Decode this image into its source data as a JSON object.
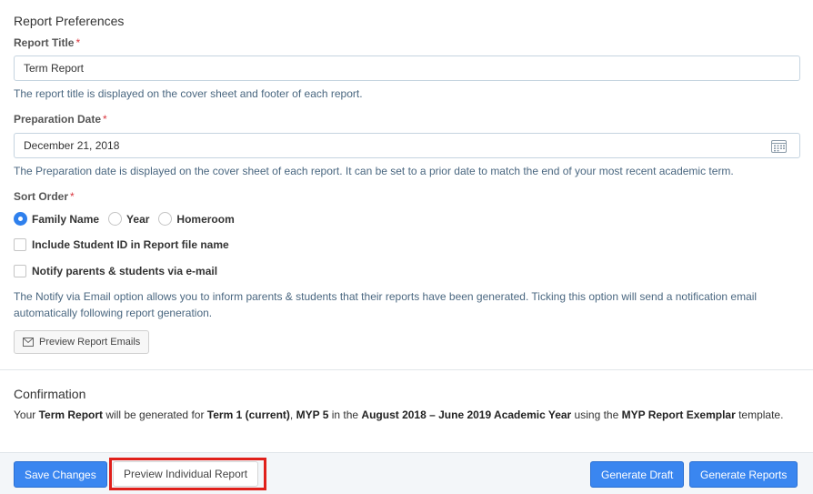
{
  "preferences": {
    "heading": "Report Preferences",
    "report_title": {
      "label": "Report Title",
      "required": "*",
      "value": "Term Report",
      "help": "The report title is displayed on the cover sheet and footer of each report."
    },
    "preparation_date": {
      "label": "Preparation Date",
      "required": "*",
      "value": "December 21, 2018",
      "icon": "calendar-icon",
      "help": "The Preparation date is displayed on the cover sheet of each report. It can be set to a prior date to match the end of your most recent academic term."
    },
    "sort_order": {
      "label": "Sort Order",
      "required": "*",
      "options": [
        "Family Name",
        "Year",
        "Homeroom"
      ],
      "selected": "Family Name"
    },
    "include_student_id": {
      "label": "Include Student ID in Report file name",
      "checked": false
    },
    "notify": {
      "label": "Notify parents & students via e-mail",
      "checked": false,
      "help": "The Notify via Email option allows you to inform parents & students that their reports have been generated. Ticking this option will send a notification email automatically following report generation."
    },
    "preview_emails_button": {
      "label": "Preview Report Emails",
      "icon": "envelope-icon"
    }
  },
  "confirmation": {
    "heading": "Confirmation",
    "text_1": "Your ",
    "report_name": "Term Report",
    "text_2": " will be generated for ",
    "term": "Term 1 (current)",
    "text_3": ", ",
    "grade": "MYP 5",
    "text_4": " in the ",
    "academic_year": "August 2018 – June 2019 Academic Year",
    "text_5": " using the ",
    "template": "MYP Report Exemplar",
    "text_6": " template."
  },
  "footer": {
    "save_label": "Save Changes",
    "preview_label": "Preview Individual Report",
    "draft_label": "Generate Draft",
    "generate_label": "Generate Reports",
    "highlight_color": "#e0201b",
    "primary_color": "#3a86f0"
  }
}
